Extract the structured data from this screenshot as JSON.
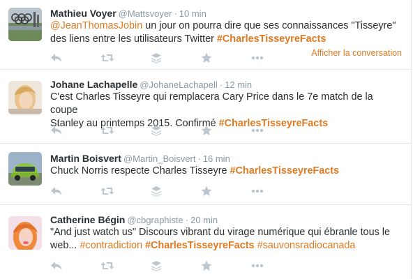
{
  "colors": {
    "accent": "#e07a22",
    "muted": "#8899a6",
    "text": "#292f33",
    "icon": "#bcc6ce"
  },
  "tweets": [
    {
      "fullname": "Mathieu Voyer",
      "username": "@Mattsvoyer",
      "separator": "·",
      "time": "10 min",
      "text_parts": [
        "@JeanThomasJobin",
        " un jour on pourra dire que ses connaissances \"Tisseyre\"",
        "des liens entre les utilisateurs Twitter ",
        "#CharlesTisseyreFacts"
      ],
      "conversation_link": "Afficher la conversation"
    },
    {
      "fullname": "Johane Lachapelle",
      "username": "@JohaneLachapell",
      "separator": "·",
      "time": "12 min",
      "text_parts": [
        "C'est Charles Tisseyre qui remplacera Cary Price dans le 7e match de la coupe",
        "Stanley au printemps 2015. Confirmé ",
        "#CharlesTisseyreFacts"
      ]
    },
    {
      "fullname": "Martin Boisvert",
      "username": "@Martin_Boisvert",
      "separator": "·",
      "time": "16 min",
      "text_parts": [
        "Chuck Norris respecte Charles Tisseyre ",
        "#CharlesTisseyreFacts"
      ]
    },
    {
      "fullname": "Catherine Bégin",
      "username": "@cbgraphiste",
      "separator": "·",
      "time": "20 min",
      "text_parts": [
        "\"And just watch us\" Discours vibrant du virage numérique qui ébranle tous le",
        "web... ",
        "#contradiction",
        " ",
        "#CharlesTisseyreFacts",
        " ",
        "#sauvonsradiocanada"
      ]
    }
  ],
  "actions": [
    "reply-icon",
    "retweet-icon",
    "buffer-icon",
    "favorite-icon",
    "more-icon"
  ]
}
